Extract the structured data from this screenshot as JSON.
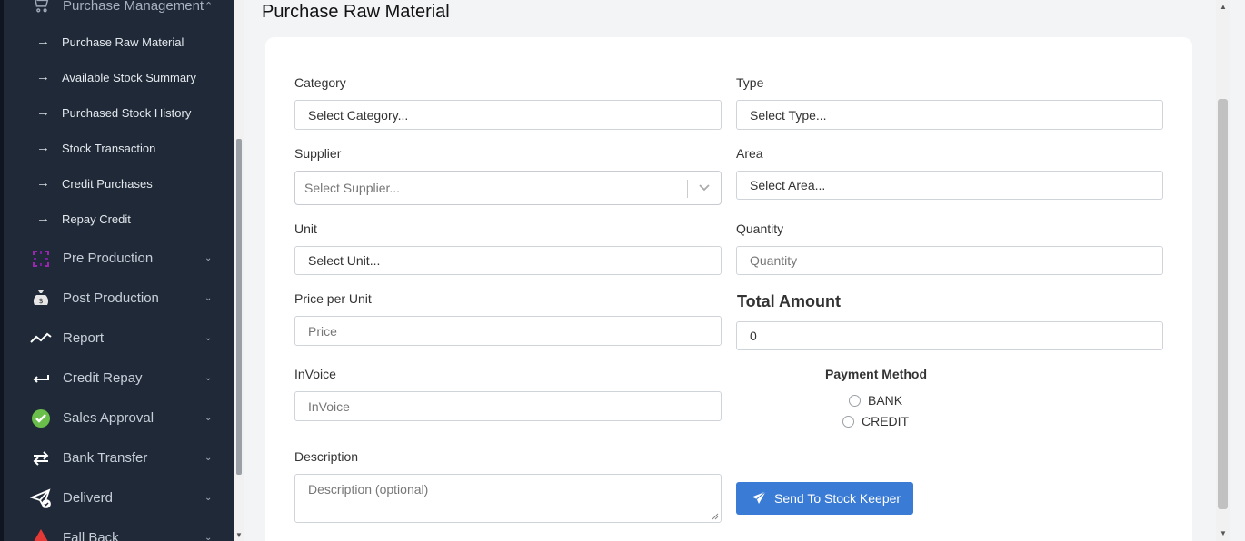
{
  "sidebar": {
    "purchase_management": {
      "label": "Purchase Management",
      "icon": "cart-icon"
    },
    "sub_items": [
      {
        "label": "Purchase Raw Material"
      },
      {
        "label": "Available Stock Summary"
      },
      {
        "label": "Purchased Stock History"
      },
      {
        "label": "Stock Transaction"
      },
      {
        "label": "Credit Purchases"
      },
      {
        "label": "Repay Credit"
      }
    ],
    "items": [
      {
        "label": "Pre Production",
        "icon": "pre-production-icon",
        "color": "#9b27b0"
      },
      {
        "label": "Post Production",
        "icon": "money-bag-icon",
        "color": "#d9d9d9"
      },
      {
        "label": "Report",
        "icon": "trend-line-icon",
        "color": "#ffffff"
      },
      {
        "label": "Credit Repay",
        "icon": "return-arrow-icon",
        "color": "#ffffff"
      },
      {
        "label": "Sales Approval",
        "icon": "check-badge-icon",
        "color": "#6abf4b"
      },
      {
        "label": "Bank Transfer",
        "icon": "swap-arrows-icon",
        "color": "#ffffff"
      },
      {
        "label": "Deliverd",
        "icon": "paper-plane-check-icon",
        "color": "#ffffff"
      },
      {
        "label": "Fall Back",
        "icon": "warning-icon",
        "color": "#e53935"
      }
    ]
  },
  "page": {
    "title": "Purchase Raw Material"
  },
  "form": {
    "category": {
      "label": "Category",
      "value": "Select Category..."
    },
    "type": {
      "label": "Type",
      "value": "Select Type..."
    },
    "supplier": {
      "label": "Supplier",
      "placeholder": "Select Supplier..."
    },
    "area": {
      "label": "Area",
      "value": "Select Area..."
    },
    "unit": {
      "label": "Unit",
      "value": "Select Unit..."
    },
    "quantity": {
      "label": "Quantity",
      "placeholder": "Quantity"
    },
    "price": {
      "label": "Price per Unit",
      "placeholder": "Price"
    },
    "total": {
      "label": "Total Amount",
      "value": "0"
    },
    "invoice": {
      "label": "InVoice",
      "placeholder": "InVoice"
    },
    "payment": {
      "label": "Payment Method",
      "options": [
        "BANK",
        "CREDIT"
      ]
    },
    "description": {
      "label": "Description",
      "placeholder": "Description (optional)"
    },
    "submit_label": "Send To Stock Keeper"
  },
  "colors": {
    "accent": "#3a7bd5",
    "sidebar_bg": "#1f2937"
  }
}
